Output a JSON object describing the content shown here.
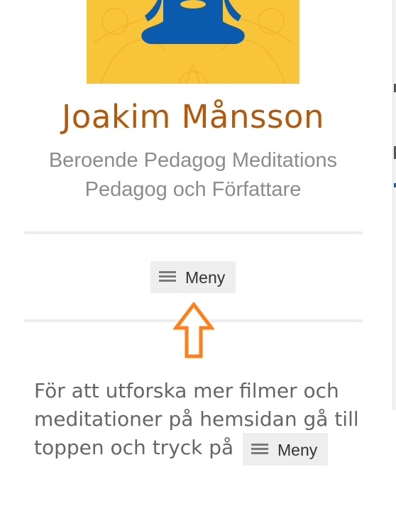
{
  "site": {
    "title": "Joakim Månsson",
    "description": "Beroende Pedagog Meditations Pedagog och Författare"
  },
  "menu": {
    "label": "Meny",
    "icon": "hamburger-icon"
  },
  "note": {
    "line1": "För att utforska mer filmer och",
    "line2": "meditationer på hemsidan gå till",
    "line3": "toppen och tryck på",
    "button_label": "Meny"
  },
  "colors": {
    "title": "#b15a0b",
    "header_background": "#f8c43a",
    "figure": "#0a5aad",
    "arrow": "#ff7f1a",
    "button_bg": "#eeeeee"
  }
}
